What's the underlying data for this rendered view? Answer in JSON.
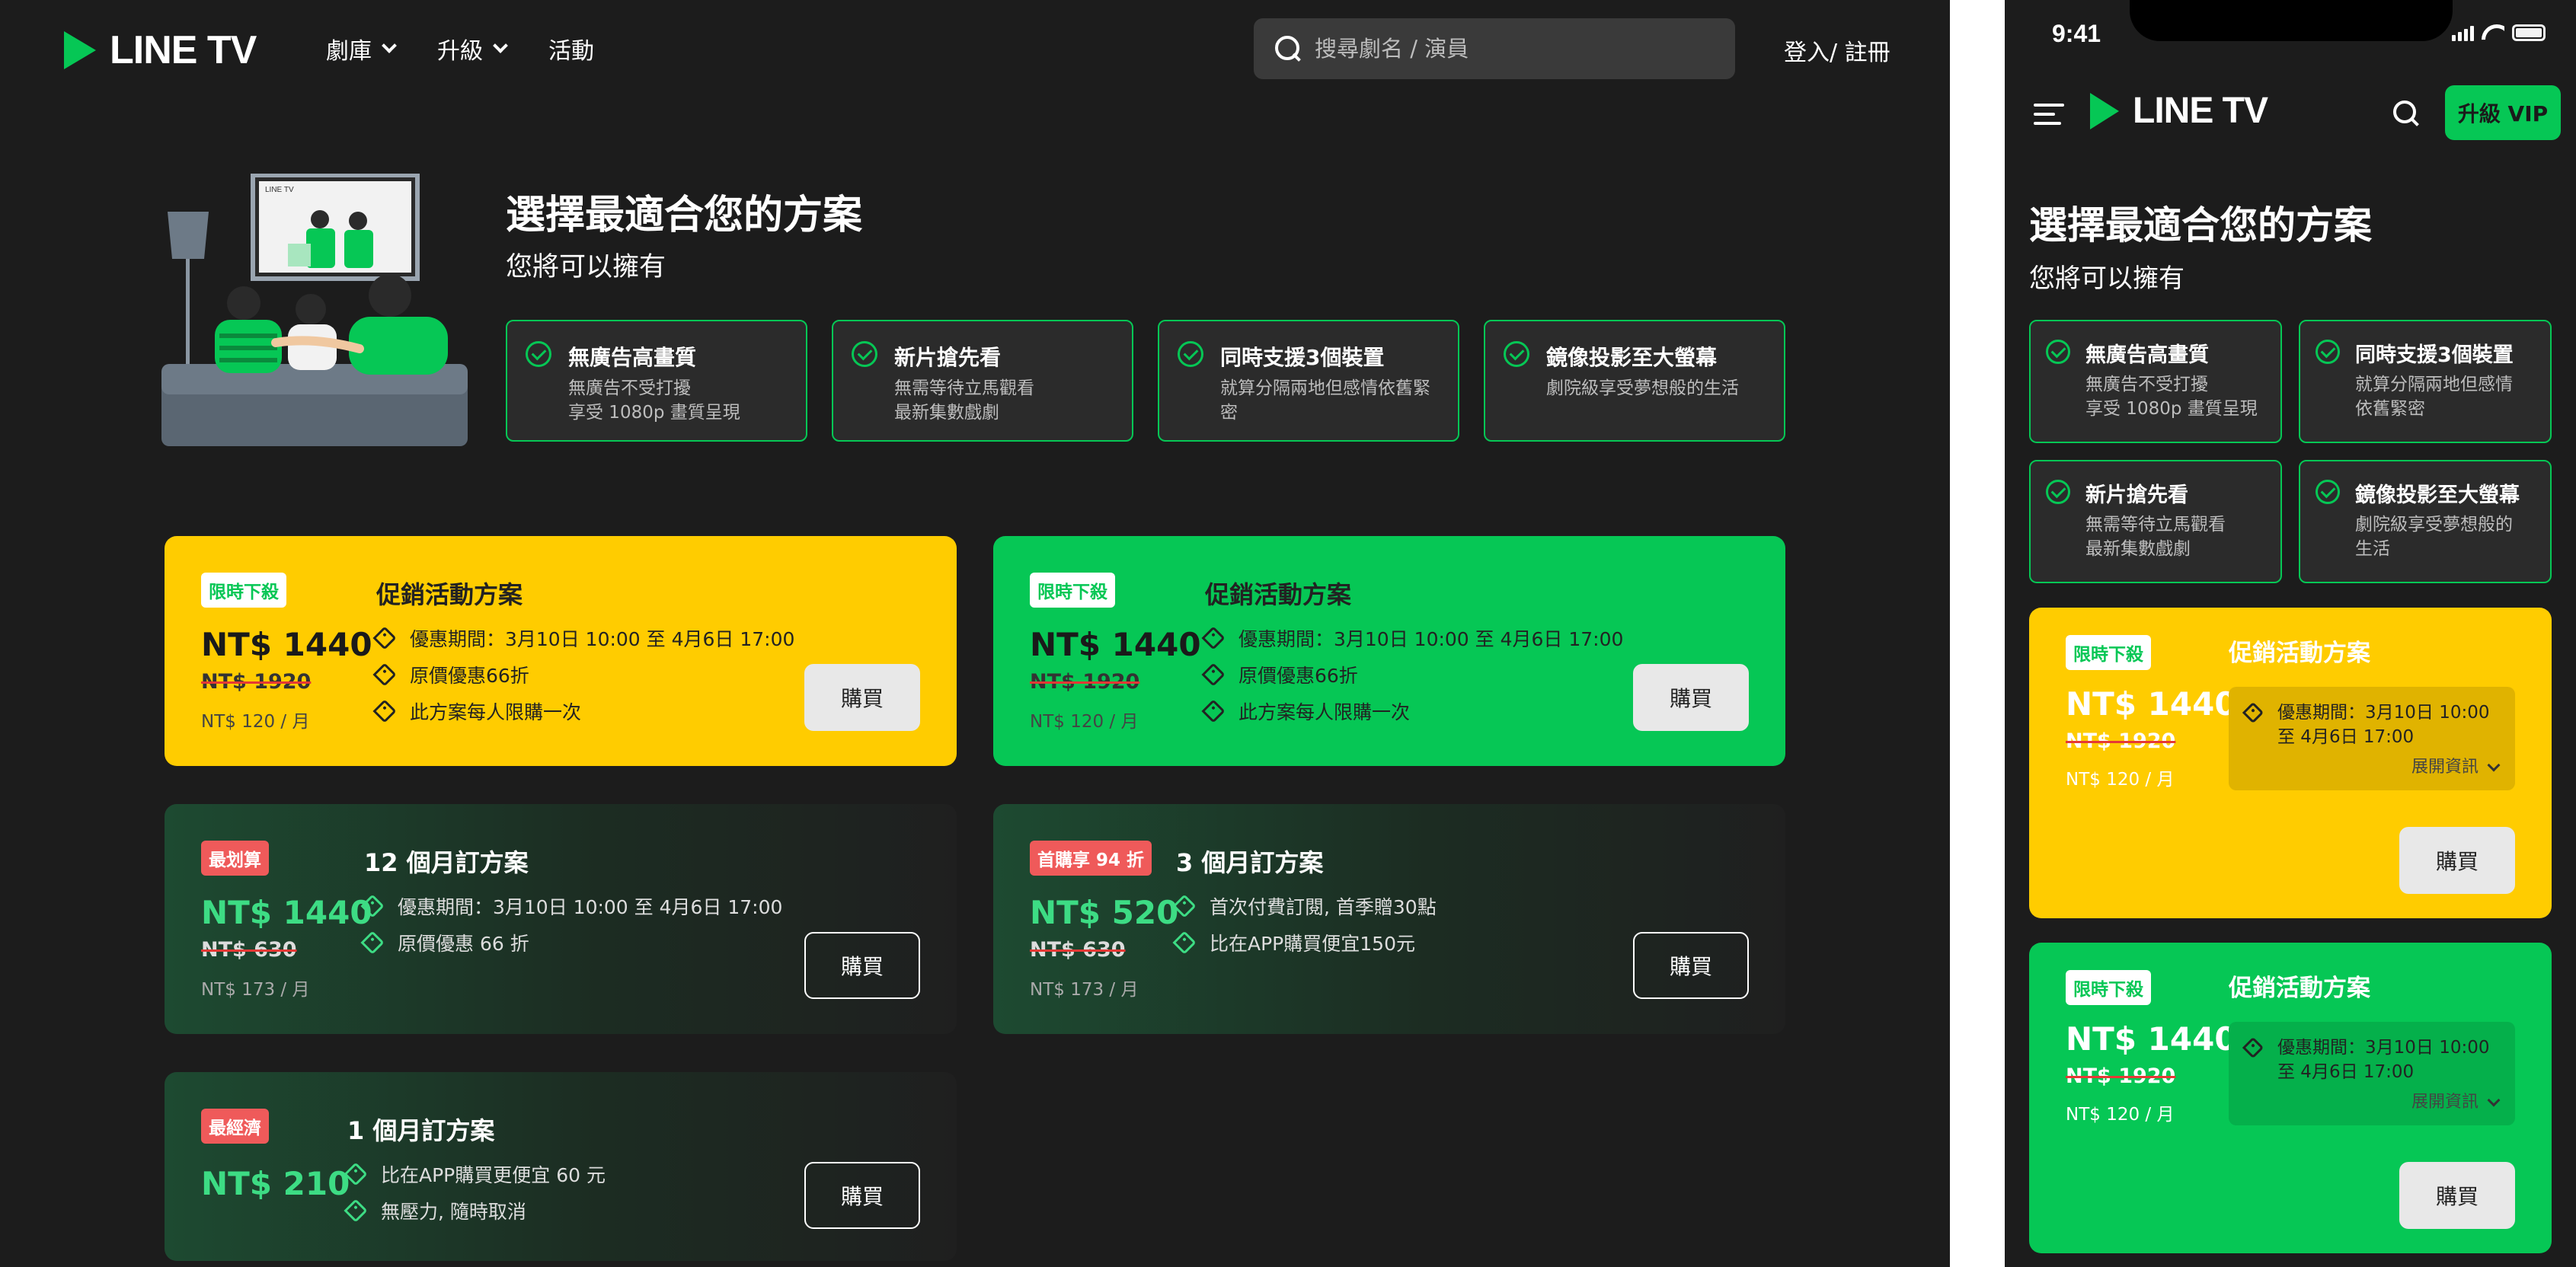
{
  "brand": {
    "name": "LINE TV",
    "accent": "#06c755",
    "yellow": "#ffcc00"
  },
  "nav": {
    "library": "劇庫",
    "upgrade": "升級",
    "events": "活動",
    "search_placeholder": "搜尋劇名 / 演員",
    "login": "登入/ 註冊"
  },
  "hero": {
    "title": "選擇最適合您的方案",
    "subtitle": "您將可以擁有",
    "tv_logo": "LINE TV"
  },
  "features": [
    {
      "title": "無廣告高畫質",
      "line1": "無廣告不受打擾",
      "line2": "享受 1080p 畫質呈現"
    },
    {
      "title": "新片搶先看",
      "line1": "無需等待立馬觀看",
      "line2": "最新集數戲劇"
    },
    {
      "title": "同時支援3個裝置",
      "line1": "就算分隔兩地但感情依舊緊",
      "line2": "密"
    },
    {
      "title": "鏡像投影至大螢幕",
      "line1": "劇院級享受夢想般的生活",
      "line2": ""
    }
  ],
  "plans": [
    {
      "badge": "限時下殺",
      "price": "NT$ 1440",
      "original": "NT$ 1920",
      "per_month": "NT$ 120 / 月",
      "title": "促銷活動方案",
      "bullets": [
        "優惠期間：3月10日 10:00 至 4月6日 17:00",
        "原價優惠66折",
        "此方案每人限購一次"
      ],
      "buy": "購買"
    },
    {
      "badge": "限時下殺",
      "price": "NT$ 1440",
      "original": "NT$ 1920",
      "per_month": "NT$ 120 / 月",
      "title": "促銷活動方案",
      "bullets": [
        "優惠期間：3月10日 10:00 至 4月6日 17:00",
        "原價優惠66折",
        "此方案每人限購一次"
      ],
      "buy": "購買"
    },
    {
      "badge": "最划算",
      "price": "NT$ 1440",
      "original": "NT$ 630",
      "per_month": "NT$ 173 / 月",
      "title": "12 個月訂方案",
      "bullets": [
        "優惠期間：3月10日 10:00 至 4月6日 17:00",
        "原價優惠 66 折"
      ],
      "buy": "購買"
    },
    {
      "badge": "首購享 94 折",
      "price": "NT$ 520",
      "original": "NT$ 630",
      "per_month": "NT$ 173 / 月",
      "title": "3 個月訂方案",
      "bullets": [
        "首次付費訂閱, 首季贈30點",
        "比在APP購買便宜150元"
      ],
      "buy": "購買"
    },
    {
      "badge": "最經濟",
      "price": "NT$ 210",
      "title": "1 個月訂方案",
      "bullets": [
        "比在APP購買更便宜 60 元",
        "無壓力, 隨時取消"
      ],
      "buy": "購買"
    }
  ],
  "mobile": {
    "time": "9:41",
    "vip": "升級 VIP",
    "features": [
      {
        "title": "無廣告高畫質",
        "line1": "無廣告不受打擾",
        "line2": "享受 1080p 畫質呈現"
      },
      {
        "title": "同時支援3個裝置",
        "line1": "就算分隔兩地但感情",
        "line2": "依舊緊密"
      },
      {
        "title": "新片搶先看",
        "line1": "無需等待立馬觀看",
        "line2": "最新集數戲劇"
      },
      {
        "title": "鏡像投影至大螢幕",
        "line1": "劇院級享受夢想般的",
        "line2": "生活"
      }
    ],
    "plans": [
      {
        "badge": "限時下殺",
        "price": "NT$ 1440",
        "original": "NT$ 1920",
        "per_month": "NT$ 120 / 月",
        "title": "促銷活動方案",
        "info_line1": "優惠期間：3月10日 10:00",
        "info_line2": "至 4月6日 17:00",
        "expand": "展開資訊",
        "buy": "購買"
      },
      {
        "badge": "限時下殺",
        "price": "NT$ 1440",
        "original": "NT$ 1920",
        "per_month": "NT$ 120 / 月",
        "title": "促銷活動方案",
        "info_line1": "優惠期間：3月10日 10:00",
        "info_line2": "至 4月6日 17:00",
        "expand": "展開資訊",
        "buy": "購買"
      }
    ]
  }
}
